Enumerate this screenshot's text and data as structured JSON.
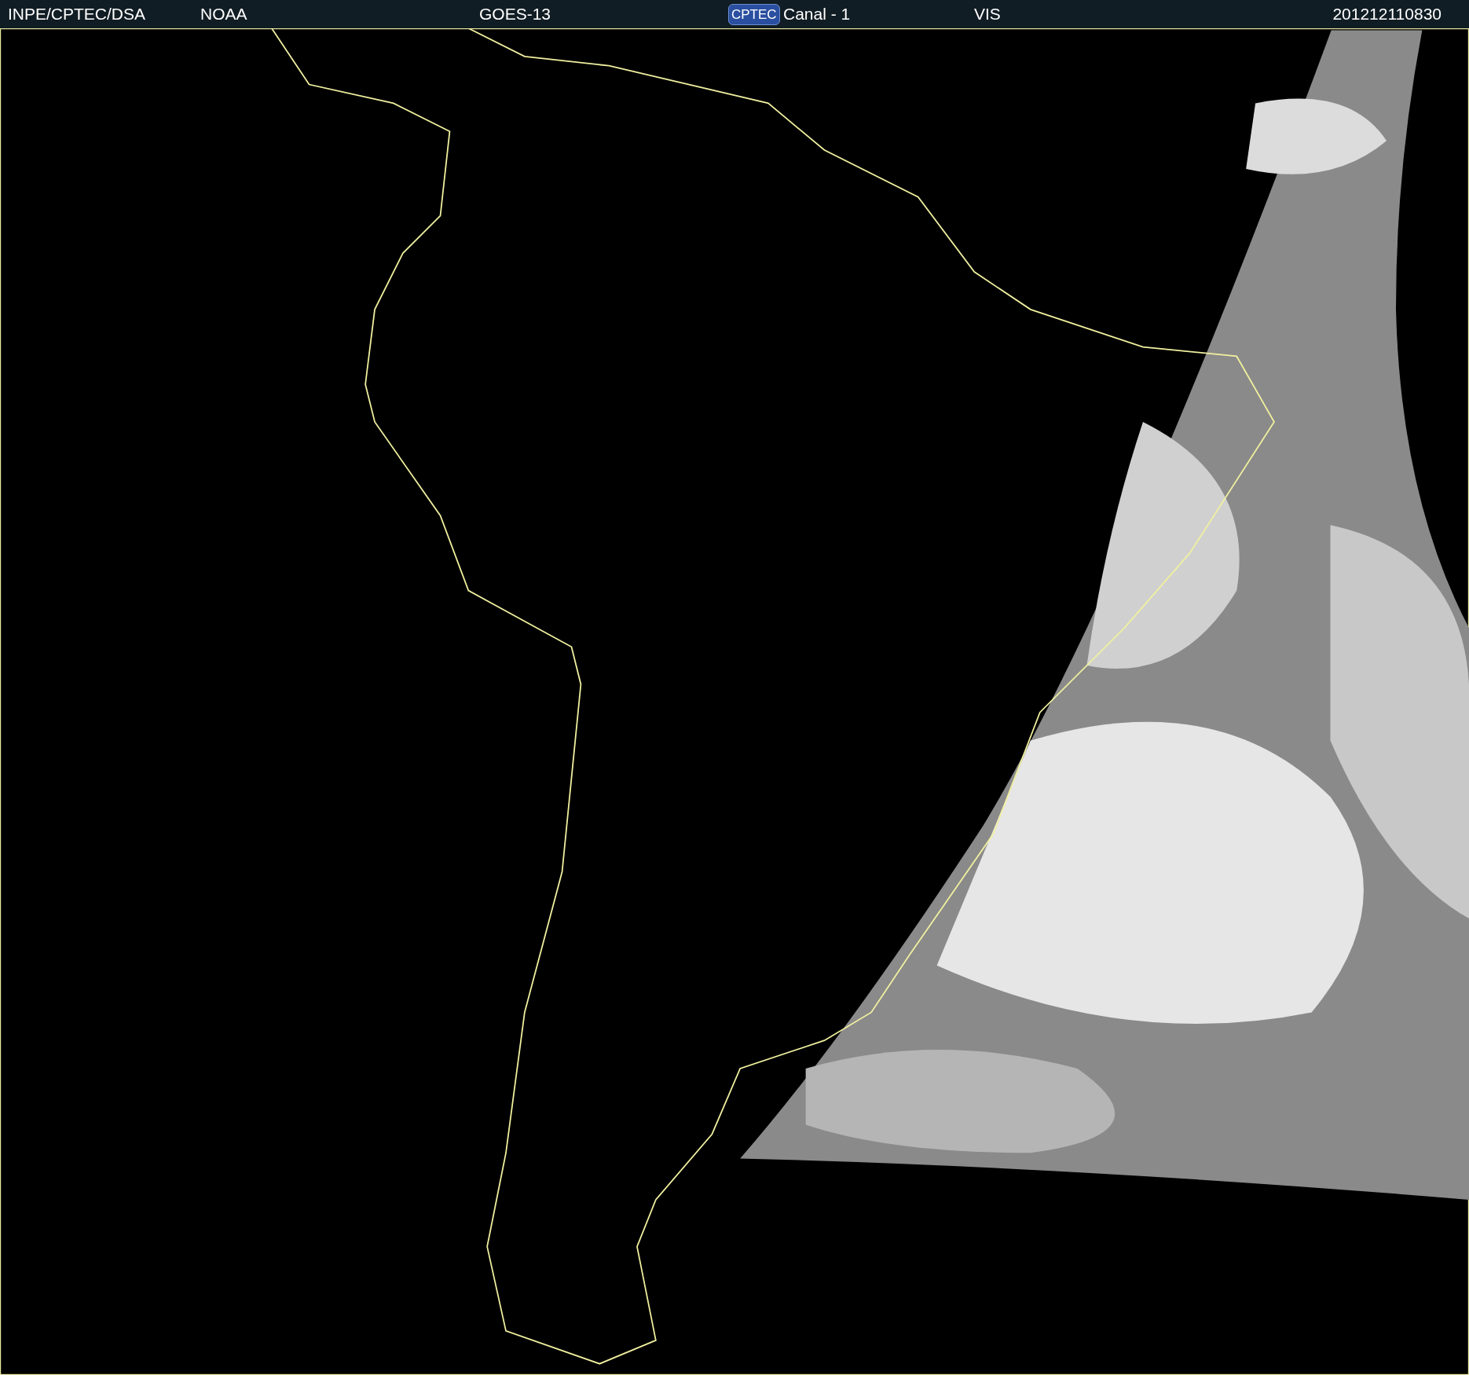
{
  "header": {
    "source": "INPE/CPTEC/DSA",
    "agency": "NOAA",
    "satellite": "GOES-13",
    "logo": "CPTEC",
    "channel": "Canal - 1",
    "band": "VIS",
    "timestamp": "201212110830"
  }
}
